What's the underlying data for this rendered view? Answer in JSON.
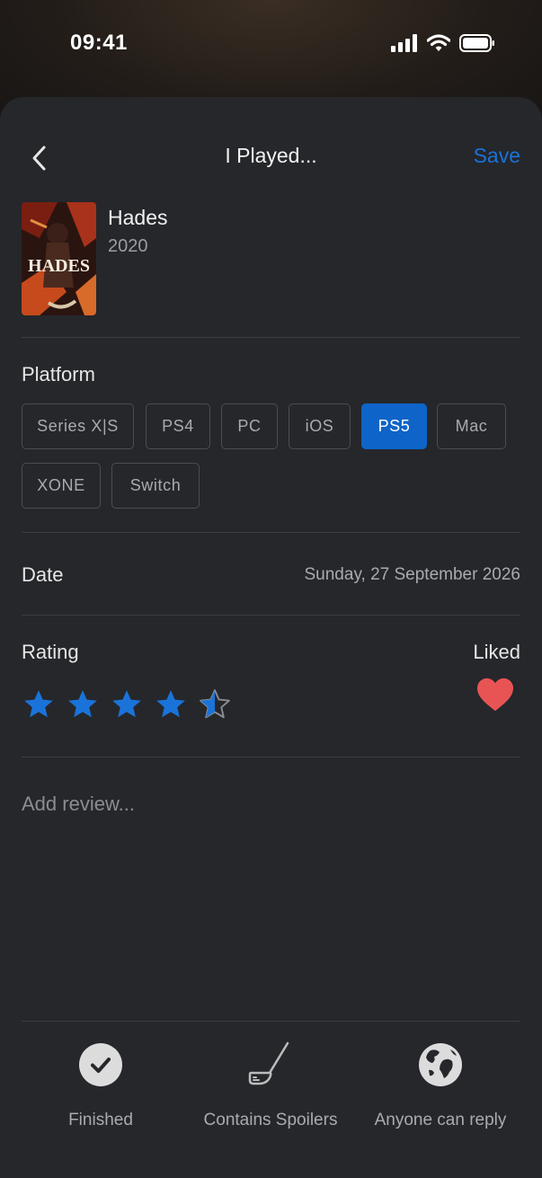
{
  "status_bar": {
    "time": "09:41",
    "icons": [
      "signal-icon",
      "wifi-icon",
      "battery-icon"
    ]
  },
  "nav": {
    "title": "I Played...",
    "save_label": "Save",
    "back_icon": "chevron-left-icon"
  },
  "game": {
    "title": "Hades",
    "year": "2020",
    "cover_text": "HADES"
  },
  "platform": {
    "label": "Platform",
    "options": [
      "Series X|S",
      "PS4",
      "PC",
      "iOS",
      "PS5",
      "Mac",
      "XONE",
      "Switch"
    ],
    "selected": "PS5"
  },
  "date": {
    "label": "Date",
    "value": "Sunday, 27 September 2026"
  },
  "rating": {
    "label": "Rating",
    "value": 4.5,
    "max": 5,
    "liked_label": "Liked",
    "liked": true
  },
  "review": {
    "placeholder": "Add review..."
  },
  "actions": [
    {
      "label": "Finished",
      "icon": "checkmark-circle-icon"
    },
    {
      "label": "Contains Spoilers",
      "icon": "golf-club-icon"
    },
    {
      "label": "Anyone can reply",
      "icon": "globe-icon"
    }
  ],
  "colors": {
    "accent": "#1a73d9",
    "selected_chip": "#0e64c8",
    "heart": "#e85454",
    "sheet": "#25272b"
  }
}
